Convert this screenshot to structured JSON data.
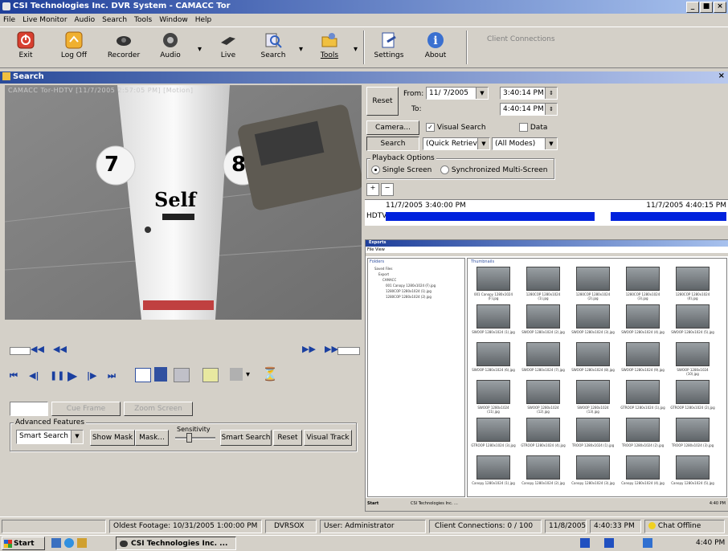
{
  "window": {
    "title": "CSI Technologies Inc. DVR System - CAMACC Tor",
    "controls": [
      "_",
      "■",
      "×"
    ]
  },
  "menu": [
    "File",
    "Live Monitor",
    "Audio",
    "Search",
    "Tools",
    "Window",
    "Help"
  ],
  "toolbar": {
    "buttons": [
      {
        "label": "Exit",
        "icon": "exit-icon",
        "color": "#d03020"
      },
      {
        "label": "Log Off",
        "icon": "logoff-icon",
        "color": "#e0a020"
      },
      {
        "label": "Recorder",
        "icon": "recorder-icon",
        "color": "#303030"
      },
      {
        "label": "Audio",
        "icon": "audio-icon",
        "color": "#303030"
      },
      {
        "label": "Live",
        "icon": "live-icon",
        "color": "#303030"
      },
      {
        "label": "Search",
        "icon": "search-icon",
        "color": "#3060c0"
      },
      {
        "label": "Tools",
        "icon": "tools-icon",
        "color": "#e0b020"
      },
      {
        "label": "Settings",
        "icon": "settings-icon",
        "color": "#3050a0"
      },
      {
        "label": "About",
        "icon": "about-icon",
        "color": "#3060c0"
      }
    ],
    "client_connections": "Client Connections"
  },
  "search_window": {
    "title": "Search",
    "close": "×"
  },
  "video": {
    "overlay": "CAMACC Tor-HDTV [11/7/2005 2:57:05 PM] [Motion]",
    "pole_numbers": [
      "7",
      "8"
    ],
    "pole_text": "Self"
  },
  "transport": {
    "cue_frame": "Cue Frame",
    "zoom_screen": "Zoom Screen",
    "advanced_features_label": "Advanced Features",
    "smart_search_select": "Smart Search",
    "show_mask": "Show Mask",
    "mask": "Mask...",
    "sensitivity": "Sensitivity",
    "smart_search": "Smart Search",
    "reset": "Reset",
    "visual_track": "Visual Track"
  },
  "search_panel": {
    "reset": "Reset",
    "from_label": "From:",
    "from_date": "11/ 7/2005",
    "from_time": "3:40:14 PM",
    "to_label": "To:",
    "to_time": "4:40:14 PM",
    "camera_button": "Camera...",
    "visual_search_label": "Visual Search",
    "visual_search_checked": true,
    "data_label": "Data",
    "data_checked": false,
    "search_button": "Search",
    "retrieve_mode": "(Quick Retrieve)",
    "modes": "(All Modes)",
    "playback_options_label": "Playback Options",
    "single_screen": "Single Screen",
    "sync_multi": "Synchronized Multi-Screen",
    "timeline_start": "11/7/2005 3:40:00 PM",
    "timeline_end": "11/7/2005 4:40:15 PM",
    "track_label": "HDTV",
    "track_color": "#0022dd"
  },
  "explorer": {
    "title": "Exports",
    "menu": "File  View",
    "tree_header": "Folders",
    "files_header": "Thumbnails",
    "tree_items": [
      "Saved Files",
      "Export",
      "CAMACC",
      "001 Canopy 1280x1024 (F).jpg",
      "1280COP 1280x1024 (1).jpg",
      "1280COP 1280x1024 (2).jpg"
    ],
    "thumb_labels": [
      "001 Canopy 1280x1024 (F).jpg",
      "1280COP 1280x1024 (1).jpg",
      "1280COP 1280x1024 (2).jpg",
      "1280COP 1280x1024 (3).jpg",
      "1280COP 1280x1024 (4).jpg",
      "SWOOP 1280x1024 (1).jpg",
      "SWOOP 1280x1024 (2).jpg",
      "SWOOP 1280x1024 (3).jpg",
      "SWOOP 1280x1024 (4).jpg",
      "SWOOP 1280x1024 (5).jpg",
      "SWOOP 1280x1024 (6).jpg",
      "SWOOP 1280x1024 (7).jpg",
      "SWOOP 1280x1024 (8).jpg",
      "SWOOP 1280x1024 (9).jpg",
      "SWOOP 1280x1024 (10).jpg",
      "SWOOP 1280x1024 (11).jpg",
      "SWOOP 1280x1024 (12).jpg",
      "SWOOP 1280x1024 (13).jpg",
      "GTROOP 1280x1024 (1).jpg",
      "GTROOP 1280x1024 (2).jpg",
      "GTROOP 1280x1024 (3).jpg",
      "GTROOP 1280x1024 (4).jpg",
      "TROOP 1280x1024 (1).jpg",
      "TROOP 1280x1024 (2).jpg",
      "TROOP 1280x1024 (3).jpg",
      "Canopy 1280x1024 (1).jpg",
      "Canopy 1280x1024 (2).jpg",
      "Canopy 1280x1024 (3).jpg",
      "Canopy 1280x1024 (4).jpg",
      "Canopy 1280x1024 (5).jpg"
    ]
  },
  "status": {
    "oldest": "Oldest Footage: 10/31/2005 1:00:00 PM",
    "server": "DVRSOX",
    "user": "User: Administrator",
    "connections": "Client Connections: 0 / 100",
    "date": "11/8/2005",
    "time": "4:40:33 PM",
    "chat": "Chat Offline"
  },
  "taskbar": {
    "start": "Start",
    "task": "CSI Technologies Inc. ...",
    "clock": "4:40 PM"
  }
}
